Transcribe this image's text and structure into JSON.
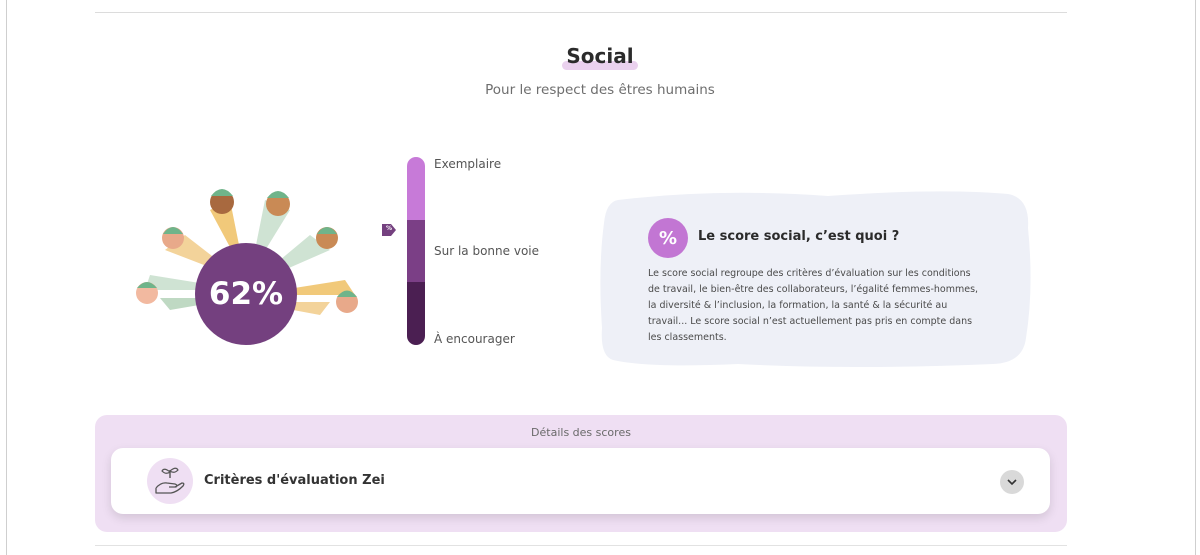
{
  "header": {
    "title": "Social",
    "subtitle": "Pour le respect des êtres humains"
  },
  "score": {
    "value": "62%",
    "marker_symbol": "%",
    "level_current": "Sur la bonne voie"
  },
  "gauge": {
    "levels": [
      "Exemplaire",
      "Sur la bonne voie",
      "À encourager"
    ]
  },
  "info": {
    "icon_symbol": "%",
    "title": "Le score social, c’est quoi ?",
    "text": "Le score social regroupe des critères d’évaluation sur les conditions de travail, le bien-être des collaborateurs, l’égalité femmes-hommes, la diversité & l’inclusion, la formation, la santé & la sécurité au travail... Le score social n’est actuellement pas pris en compte dans les classements."
  },
  "details": {
    "label": "Détails des scores",
    "criteria_title": "Critères d'évaluation Zei",
    "criteria_icon": "hand-seedling-icon",
    "chevron_icon": "chevron-down-icon"
  },
  "colors": {
    "accent_purple": "#74407f",
    "light_purple": "#c77ad8",
    "dark_purple": "#4b1f52",
    "details_bg": "#efdff3",
    "info_card_bg": "#eef0f7"
  }
}
